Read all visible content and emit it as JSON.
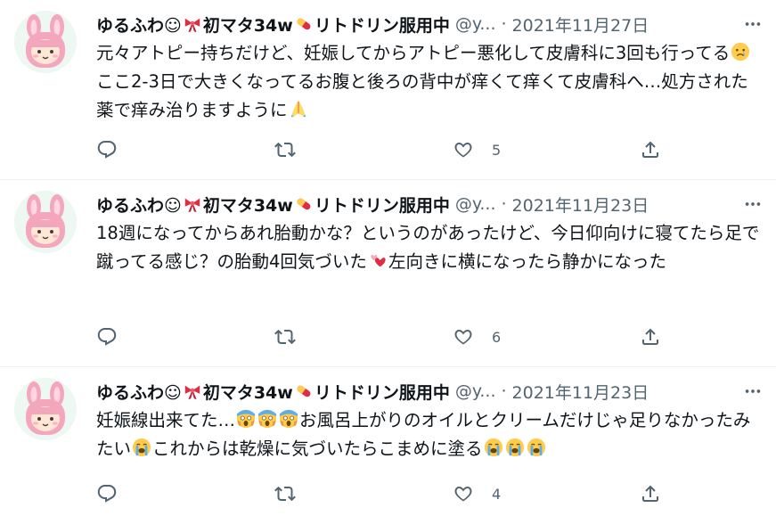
{
  "tweets": [
    {
      "name_prefix": "ゆるふわ☺",
      "name_mid": "初マタ34w",
      "name_suffix": "リトドリン服用中",
      "handle": "@y...",
      "separator": "·",
      "date": "2021年11月27日",
      "text_a": "元々アトピー持ちだけど、妊娠してからアトピー悪化して皮膚科に3回も行ってる",
      "text_b": "ここ2-3日で大きくなってるお腹と後ろの背中が痒くて痒くて皮膚科へ…処方された薬で痒み治りますように",
      "emoji_a": "crying-face",
      "emoji_b": "folded-hands",
      "like_count": "5"
    },
    {
      "name_prefix": "ゆるふわ☺",
      "name_mid": "初マタ34w",
      "name_suffix": "リトドリン服用中",
      "handle": "@y...",
      "separator": "·",
      "date": "2021年11月23日",
      "text_a": "18週になってからあれ胎動かな？というのがあったけど、今日仰向けに寝てたら足で蹴ってる感じ？の胎動4回気づいた",
      "text_b": "左向きに横になったら静かになった",
      "emoji_a": "two-hearts",
      "like_count": "6"
    },
    {
      "name_prefix": "ゆるふわ☺",
      "name_mid": "初マタ34w",
      "name_suffix": "リトドリン服用中",
      "handle": "@y...",
      "separator": "·",
      "date": "2021年11月23日",
      "text_a": "妊娠線出来てた…",
      "text_b": "お風呂上がりのオイルとクリームだけじゃ足りなかったみたい",
      "text_c": "これからは乾燥に気づいたらこまめに塗る",
      "emoji_a": "screaming-face x3",
      "emoji_b": "loudly-crying-face",
      "emoji_c": "loudly-crying-face x3",
      "like_count": "4"
    }
  ],
  "colors": {
    "text": "#0f1419",
    "secondary": "#536471",
    "divider": "#eff3f4",
    "avatar_pink": "#f4a6bd",
    "bow_red": "#dd2e44",
    "pill_yellow": "#ffcc4d"
  }
}
